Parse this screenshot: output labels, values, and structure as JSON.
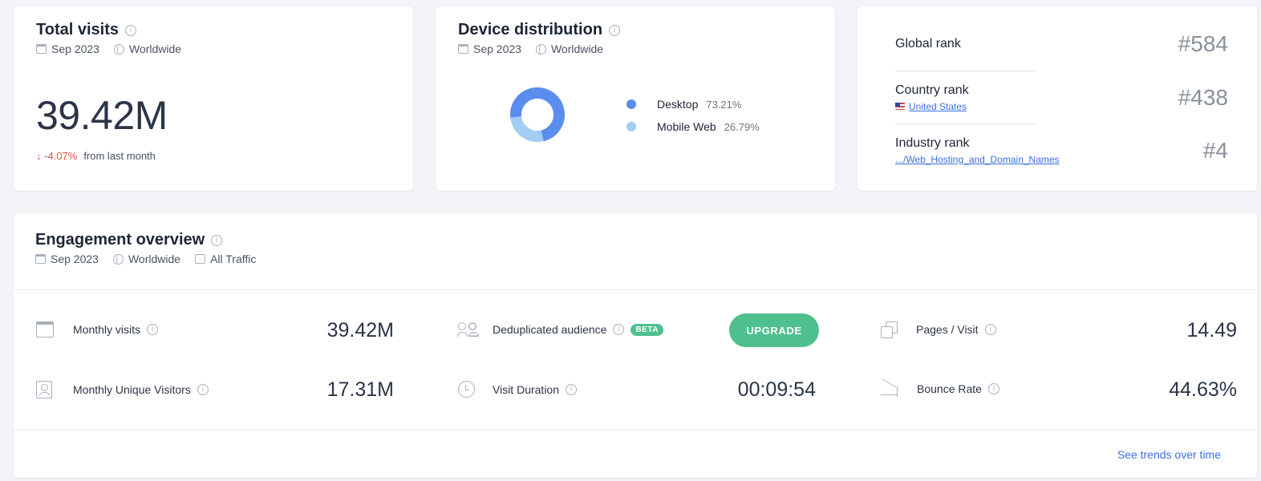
{
  "total_visits": {
    "title": "Total visits",
    "date": "Sep 2023",
    "region": "Worldwide",
    "value": "39.42M",
    "change": "↓ -4.07%",
    "change_label": "from last month"
  },
  "device_distribution": {
    "title": "Device distribution",
    "date": "Sep 2023",
    "region": "Worldwide",
    "chart_data": {
      "type": "pie",
      "categories": [
        "Desktop",
        "Mobile Web"
      ],
      "values": [
        73.21,
        26.79
      ],
      "colors": [
        "#5b8def",
        "#a3cdf5"
      ],
      "title": ""
    },
    "legend": [
      {
        "name": "Desktop",
        "value": "73.21%",
        "color": "#5b8def"
      },
      {
        "name": "Mobile Web",
        "value": "26.79%",
        "color": "#a3cdf5"
      }
    ]
  },
  "ranks": {
    "global_label": "Global rank",
    "global_value": "#584",
    "country_label": "Country rank",
    "country_link": "United States",
    "country_value": "#438",
    "industry_label": "Industry rank",
    "industry_link": ".../Web_Hosting_and_Domain_Names",
    "industry_value": "#4"
  },
  "engagement": {
    "title": "Engagement overview",
    "date": "Sep 2023",
    "region": "Worldwide",
    "traffic": "All Traffic",
    "monthly_visits_label": "Monthly visits",
    "monthly_visits_value": "39.42M",
    "unique_visitors_label": "Monthly Unique Visitors",
    "unique_visitors_value": "17.31M",
    "dedup_label": "Deduplicated audience",
    "beta_label": "BETA",
    "upgrade_label": "UPGRADE",
    "visit_duration_label": "Visit Duration",
    "visit_duration_value": "00:09:54",
    "pages_visit_label": "Pages / Visit",
    "pages_visit_value": "14.49",
    "bounce_rate_label": "Bounce Rate",
    "bounce_rate_value": "44.63%",
    "trends_link": "See trends over time"
  },
  "colors": {
    "accent_green": "#4ec08e",
    "negative_red": "#e1553e",
    "link_blue": "#3b6fe0"
  },
  "icons": [
    "info-icon",
    "calendar-icon",
    "globe-icon",
    "traffic-icon",
    "flag-us-icon",
    "users-icon",
    "clock-icon",
    "pages-icon",
    "bounce-icon",
    "person-card-icon"
  ]
}
